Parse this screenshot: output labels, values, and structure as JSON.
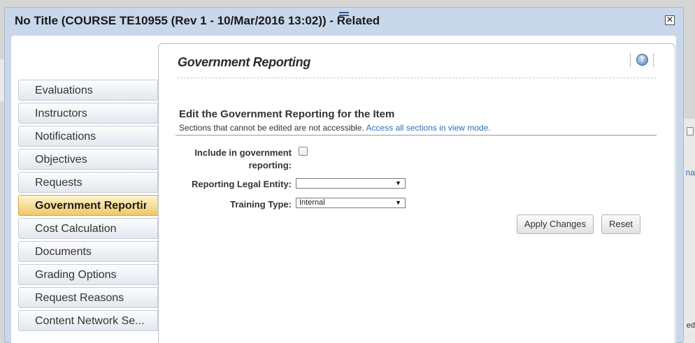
{
  "modal": {
    "title": "No Title (COURSE TE10955 (Rev 1 - 10/Mar/2016 13:02)) - Related",
    "close_symbol": "✕"
  },
  "sidebar": {
    "items": [
      {
        "label": "Evaluations",
        "active": false
      },
      {
        "label": "Instructors",
        "active": false
      },
      {
        "label": "Notifications",
        "active": false
      },
      {
        "label": "Objectives",
        "active": false
      },
      {
        "label": "Requests",
        "active": false
      },
      {
        "label": "Government Reporting",
        "active": true
      },
      {
        "label": "Cost Calculation",
        "active": false
      },
      {
        "label": "Documents",
        "active": false
      },
      {
        "label": "Grading Options",
        "active": false
      },
      {
        "label": "Request Reasons",
        "active": false
      },
      {
        "label": "Content Network Se...",
        "active": false
      }
    ]
  },
  "panel": {
    "title": "Government Reporting",
    "help_icon": "question-mark-icon",
    "section_heading": "Edit the Government Reporting for the Item",
    "section_note": "Sections that cannot be edited are not accessible.",
    "section_link": "Access all sections in view mode."
  },
  "form": {
    "include_label_line1": "Include in government",
    "include_label_line2": "reporting:",
    "include_checked": false,
    "legal_entity_label": "Reporting Legal Entity:",
    "legal_entity_value": "",
    "training_type_label": "Training Type:",
    "training_type_value": "Internal",
    "caret": "▼"
  },
  "buttons": {
    "apply": "Apply Changes",
    "reset": "Reset"
  },
  "background": {
    "right_text_1": "na",
    "right_text_2": "ed"
  },
  "colors": {
    "modal_bg": "#c8d7e9",
    "active_tab": "#f0c866",
    "link": "#2f6fb8"
  }
}
